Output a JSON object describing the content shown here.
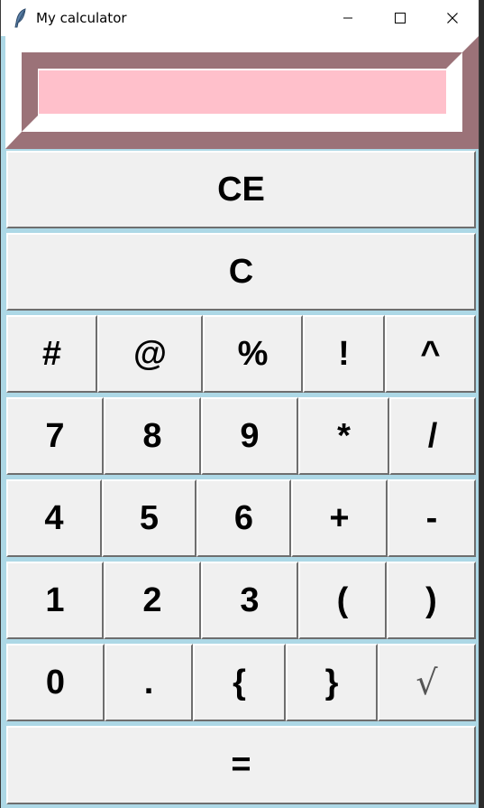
{
  "window": {
    "title": "My calculator",
    "controls": {
      "minimize": "minimize-icon",
      "maximize": "maximize-icon",
      "close": "close-icon"
    }
  },
  "display": {
    "value": "",
    "background": "#ffc0cb",
    "bevel_color": "#9b7278"
  },
  "colors": {
    "window_bg": "#add8e6",
    "key_bg": "#f0f0f0"
  },
  "keys": {
    "row1": [
      "CE"
    ],
    "row2": [
      "C"
    ],
    "row3": [
      "#",
      "@",
      "%",
      "!",
      "^"
    ],
    "row4": [
      "7",
      "8",
      "9",
      "*",
      "/"
    ],
    "row5": [
      "4",
      "5",
      "6",
      "+",
      "-"
    ],
    "row6": [
      "1",
      "2",
      "3",
      "(",
      ")"
    ],
    "row7": [
      "0",
      ".",
      "{",
      "}",
      "√"
    ],
    "row8": [
      "="
    ]
  }
}
